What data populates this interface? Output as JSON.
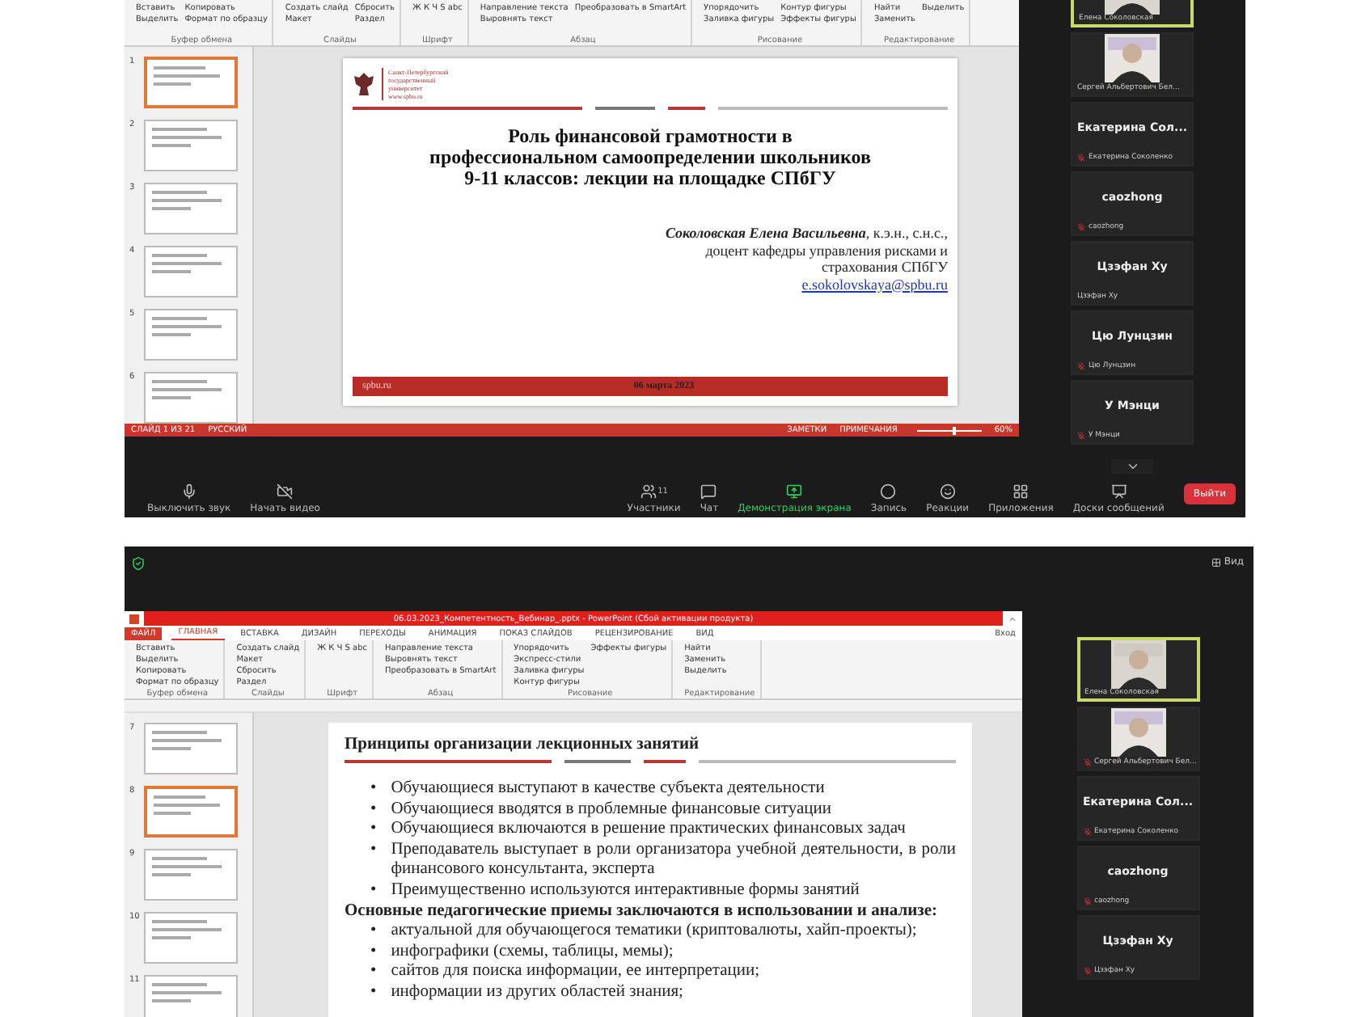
{
  "top_session": {
    "ribbon": [
      {
        "label": "Буфер обмена",
        "items": [
          "Вставить",
          "Выделить",
          "Копировать",
          "Формат по образцу"
        ]
      },
      {
        "label": "Слайды",
        "items": [
          "Создать слайд",
          "Макет",
          "Сбросить",
          "Раздел"
        ]
      },
      {
        "label": "Шрифт",
        "items": [
          "Ж К Ч S abc"
        ]
      },
      {
        "label": "Абзац",
        "items": [
          "Направление текста",
          "Выровнять текст",
          "Преобразовать в SmartArt"
        ]
      },
      {
        "label": "Рисование",
        "items": [
          "Упорядочить",
          "Заливка фигуры",
          "Контур фигуры",
          "Эффекты фигуры"
        ]
      },
      {
        "label": "Редактирование",
        "items": [
          "Найти",
          "Заменить",
          "Выделить"
        ]
      }
    ],
    "thumbnails": [
      {
        "number": "1",
        "selected": true
      },
      {
        "number": "2",
        "selected": false
      },
      {
        "number": "3",
        "selected": false
      },
      {
        "number": "4",
        "selected": false
      },
      {
        "number": "5",
        "selected": false
      },
      {
        "number": "6",
        "selected": false
      }
    ],
    "slide": {
      "logo_lines": [
        "Санкт-Петербургский",
        "государственный",
        "университет",
        "www.spbu.ru"
      ],
      "title_lines": [
        "Роль финансовой грамотности в",
        "профессиональном  самоопределении школьников",
        "9-11 классов: лекции на площадке СПбГУ"
      ],
      "author_name": "Соколовская Елена Васильевна",
      "author_degree": ", к.э.н., с.н.с.,",
      "author_lines": [
        "доцент кафедры управления рисками и",
        "страхования СПбГУ"
      ],
      "email": "e.sokolovskaya@spbu.ru",
      "footer_site": "spbu.ru",
      "footer_date": "06 марта 2023"
    },
    "status_bar": {
      "left": [
        "СЛАЙД 1 ИЗ 21",
        "РУССКИЙ"
      ],
      "right": [
        "ЗАМЕТКИ",
        "ПРИМЕЧАНИЯ"
      ],
      "zoom": "60%",
      "level": 0.55
    },
    "participants": [
      {
        "kind": "video",
        "name": "Елена Соколовская",
        "selected": true,
        "muted": false
      },
      {
        "kind": "video",
        "name": "Сергей Альбертович Бел...",
        "selected": false,
        "muted": false
      },
      {
        "kind": "name",
        "title": "Екатерина  Сол...",
        "name": "Екатерина Соколенко",
        "selected": false,
        "muted": true
      },
      {
        "kind": "name",
        "title": "caozhong",
        "name": "caozhong",
        "selected": false,
        "muted": true
      },
      {
        "kind": "name",
        "title": "Цзэфан Ху",
        "name": "Цзэфан Ху",
        "selected": false,
        "muted": false
      },
      {
        "kind": "name",
        "title": "Цю Лунцзин",
        "name": "Цю Лунцзин",
        "selected": false,
        "muted": true
      },
      {
        "kind": "name",
        "title": "У Мэнци",
        "name": "У Мэнци",
        "selected": false,
        "muted": true
      }
    ],
    "toolbar": [
      {
        "kind": "mic",
        "label": "Выключить звук"
      },
      {
        "kind": "video",
        "label": "Начать видео"
      },
      {
        "kind": "participants",
        "label": "Участники",
        "count": "11"
      },
      {
        "kind": "chat",
        "label": "Чат"
      },
      {
        "kind": "share",
        "label": "Демонстрация экрана"
      },
      {
        "kind": "record",
        "label": "Запись"
      },
      {
        "kind": "reactions",
        "label": "Реакции"
      },
      {
        "kind": "apps",
        "label": "Приложения"
      },
      {
        "kind": "boards",
        "label": "Доски сообщений"
      }
    ],
    "leave_button": "Выйти"
  },
  "bottom_session": {
    "view_button": "Вид",
    "window_title": "06.03.2023_Компетентность_Вебинар_.pptx - PowerPoint (Сбой активации продукта)",
    "tabs": [
      {
        "label": "ФАЙЛ",
        "kind": "file",
        "selected": false
      },
      {
        "label": "ГЛАВНАЯ",
        "kind": "tab",
        "selected": true
      },
      {
        "label": "ВСТАВКА",
        "kind": "tab",
        "selected": false
      },
      {
        "label": "ДИЗАЙН",
        "kind": "tab",
        "selected": false
      },
      {
        "label": "ПЕРЕХОДЫ",
        "kind": "tab",
        "selected": false
      },
      {
        "label": "АНИМАЦИЯ",
        "kind": "tab",
        "selected": false
      },
      {
        "label": "ПОКАЗ СЛАЙДОВ",
        "kind": "tab",
        "selected": false
      },
      {
        "label": "РЕЦЕНЗИРОВАНИЕ",
        "kind": "tab",
        "selected": false
      },
      {
        "label": "ВИД",
        "kind": "tab",
        "selected": false
      }
    ],
    "sign_in": "Вход",
    "ribbon": [
      {
        "label": "Буфер обмена",
        "items": [
          "Вставить",
          "Выделить",
          "Копировать",
          "Формат по образцу"
        ]
      },
      {
        "label": "Слайды",
        "items": [
          "Создать слайд",
          "Макет",
          "Сбросить",
          "Раздел"
        ]
      },
      {
        "label": "Шрифт",
        "items": [
          "Ж К Ч S abc"
        ]
      },
      {
        "label": "Абзац",
        "items": [
          "Направление текста",
          "Выровнять текст",
          "Преобразовать в SmartArt"
        ]
      },
      {
        "label": "Рисование",
        "items": [
          "Упорядочить",
          "Экспресс-стили",
          "Заливка фигуры",
          "Контур фигуры",
          "Эффекты фигуры"
        ]
      },
      {
        "label": "Редактирование",
        "items": [
          "Найти",
          "Заменить",
          "Выделить"
        ]
      }
    ],
    "thumbnails": [
      {
        "number": "7",
        "selected": false
      },
      {
        "number": "8",
        "selected": true
      },
      {
        "number": "9",
        "selected": false
      },
      {
        "number": "10",
        "selected": false
      },
      {
        "number": "11",
        "selected": false
      }
    ],
    "slide": {
      "heading": "Принципы организации лекционных занятий",
      "bullets": [
        {
          "marker": "•",
          "text": "Обучающиеся выступают в качестве субъекта деятельности"
        },
        {
          "marker": "•",
          "text": "Обучающиеся вводятся в проблемные финансовые ситуации"
        },
        {
          "marker": "•",
          "text": "Обучающиеся включаются в решение практических финансовых задач"
        },
        {
          "marker": "•",
          "text": "Преподаватель выступает в роли организатора учебной деятельности, в роли финансового консультанта, эксперта"
        },
        {
          "marker": "•",
          "text": "Преимущественно используются интерактивные формы занятий"
        }
      ],
      "subheading": "Основные педагогические приемы заключаются в использовании и анализе:",
      "bullets_2": [
        {
          "marker": "•",
          "text": "актуальной для обучающегося тематики (криптовалюты, хайп-проекты);"
        },
        {
          "marker": "•",
          "text": "инфографики (схемы, таблицы, мемы);"
        },
        {
          "marker": "•",
          "text": "сайтов для поиска информации, ее интерпретации;"
        },
        {
          "marker": "•",
          "text": "информации из других областей знания;"
        }
      ]
    },
    "participants": [
      {
        "kind": "video",
        "name": "Елена Соколовская",
        "selected": true,
        "muted": false
      },
      {
        "kind": "video",
        "name": "Сергей Альбертович Бел...",
        "selected": false,
        "muted": true
      },
      {
        "kind": "name",
        "title": "Екатерина  Сол...",
        "name": "Екатерина Соколенко",
        "selected": false,
        "muted": true
      },
      {
        "kind": "name",
        "title": "caozhong",
        "name": "caozhong",
        "selected": false,
        "muted": true
      },
      {
        "kind": "name",
        "title": "Цзэфан Ху",
        "name": "Цзэфан Ху",
        "selected": false,
        "muted": true
      }
    ]
  }
}
